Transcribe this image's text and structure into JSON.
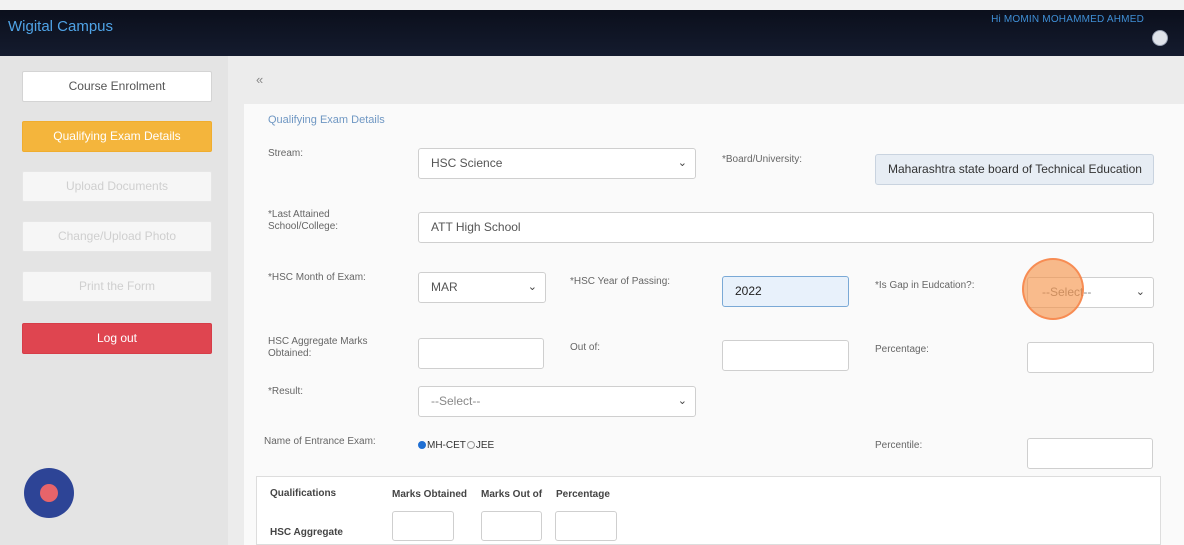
{
  "header": {
    "brand": "Wigital Campus",
    "greeting": "Hi MOMIN MOHAMMED AHMED"
  },
  "sidebar": {
    "items": [
      {
        "label": "Course Enrolment",
        "state": "normal"
      },
      {
        "label": "Qualifying Exam Details",
        "state": "active"
      },
      {
        "label": "Upload Documents",
        "state": "disabled"
      },
      {
        "label": "Change/Upload Photo",
        "state": "disabled"
      },
      {
        "label": "Print the Form",
        "state": "disabled"
      }
    ],
    "logout": "Log out"
  },
  "collapse": "«",
  "form": {
    "title": "Qualifying Exam Details",
    "stream": {
      "label": "Stream:",
      "value": "HSC Science"
    },
    "board": {
      "label": "*Board/University:",
      "value": "Maharashtra state board of Technical Education"
    },
    "school": {
      "label": "*Last Attained School/College:",
      "value": "ATT High School"
    },
    "month": {
      "label": "*HSC Month of Exam:",
      "value": "MAR"
    },
    "year": {
      "label": "*HSC Year of Passing:",
      "value": "2022"
    },
    "gap": {
      "label": "*Is Gap in Eudcation?:",
      "value": "--Select--"
    },
    "marks": {
      "label": "HSC Aggregate Marks Obtained:",
      "value": ""
    },
    "outof": {
      "label": "Out of:",
      "value": ""
    },
    "percentage": {
      "label": "Percentage:",
      "value": ""
    },
    "result": {
      "label": "*Result:",
      "value": "--Select--"
    },
    "entrance": {
      "label": "Name of Entrance Exam:",
      "options": [
        "MH-CET",
        "JEE"
      ],
      "selected": "MH-CET"
    },
    "percentile": {
      "label": "Percentile:",
      "value": ""
    }
  },
  "table": {
    "headers": [
      "Qualifications",
      "Marks Obtained",
      "Marks Out of",
      "Percentage"
    ],
    "rows": [
      {
        "label": "HSC Aggregate"
      }
    ]
  },
  "colors": {
    "active": "#f4b53c",
    "logout": "#df4550",
    "brand": "#4fa3e6"
  }
}
